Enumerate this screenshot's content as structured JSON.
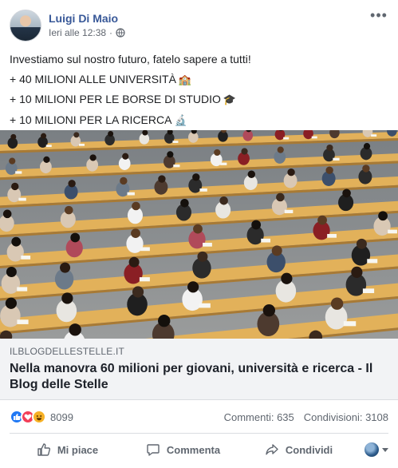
{
  "post": {
    "author": "Luigi Di Maio",
    "timestamp": "Ieri alle 12:38",
    "audience_icon": "globe-icon",
    "more_icon": "more-options-icon",
    "lines": [
      "Investiamo sul nostro futuro, fatelo sapere a tutti!",
      "+ 40 MILIONI ALLE UNIVERSITÀ",
      "+ 10 MILIONI PER LE BORSE DI STUDIO",
      "+ 10 MILIONI PER LA RICERCA"
    ],
    "line_emojis": [
      "",
      "🏫",
      "🎓",
      "🔬"
    ]
  },
  "link": {
    "domain": "ILBLOGDELLESTELLE.IT",
    "headline": "Nella manovra 60 milioni per giovani, università e ricerca - Il Blog delle Stelle"
  },
  "stats": {
    "reaction_count": "8099",
    "comments": "Commenti: 635",
    "shares": "Condivisioni: 3108",
    "reaction_icons": [
      "like-icon",
      "love-icon",
      "haha-icon"
    ]
  },
  "actions": {
    "like": "Mi piace",
    "comment": "Commenta",
    "share": "Condividi"
  },
  "colors": {
    "author": "#385898",
    "like_blue": "#2078f4",
    "love_red": "#f33e58",
    "haha_yellow": "#f7b125",
    "link_bg": "#f2f3f5"
  }
}
